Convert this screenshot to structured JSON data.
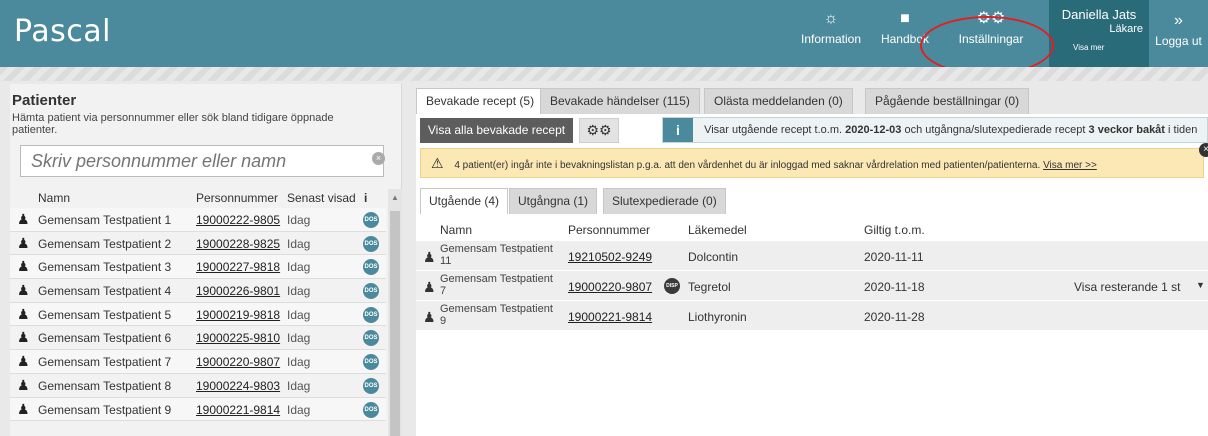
{
  "app": {
    "title": "Pascal"
  },
  "nav": [
    {
      "label": "Information",
      "icon": "lightbulb-icon",
      "glyph": "☼"
    },
    {
      "label": "Handbok",
      "icon": "book-icon",
      "glyph": "■"
    },
    {
      "label": "Inställningar",
      "icon": "gears-icon",
      "glyph": "⚙⚙"
    }
  ],
  "user": {
    "name": "Daniella Jats",
    "role": "Läkare",
    "more": "Visa mer"
  },
  "logout": {
    "label": "Logga ut",
    "glyph": "»"
  },
  "patients": {
    "title": "Patienter",
    "hint": "Hämta patient via personnummer eller sök bland tidigare öppnade patienter.",
    "search_placeholder": "Skriv personnummer eller namn",
    "columns": {
      "name": "Namn",
      "pnr": "Personnummer",
      "seen": "Senast visad",
      "info": "i"
    },
    "rows": [
      {
        "name": "Gemensam Testpatient 1",
        "pnr": "19000222-9805",
        "seen": "Idag",
        "badge": "DOS"
      },
      {
        "name": "Gemensam Testpatient 2",
        "pnr": "19000228-9825",
        "seen": "Idag",
        "badge": "DOS"
      },
      {
        "name": "Gemensam Testpatient 3",
        "pnr": "19000227-9818",
        "seen": "Idag",
        "badge": "DOS"
      },
      {
        "name": "Gemensam Testpatient 4",
        "pnr": "19000226-9801",
        "seen": "Idag",
        "badge": "DOS"
      },
      {
        "name": "Gemensam Testpatient 5",
        "pnr": "19000219-9818",
        "seen": "Idag",
        "badge": "DOS"
      },
      {
        "name": "Gemensam Testpatient 6",
        "pnr": "19000225-9810",
        "seen": "Idag",
        "badge": "DOS"
      },
      {
        "name": "Gemensam Testpatient 7",
        "pnr": "19000220-9807",
        "seen": "Idag",
        "badge": "DOS"
      },
      {
        "name": "Gemensam Testpatient 8",
        "pnr": "19000224-9803",
        "seen": "Idag",
        "badge": "DOS"
      },
      {
        "name": "Gemensam Testpatient 9",
        "pnr": "19000221-9814",
        "seen": "Idag",
        "badge": "DOS"
      }
    ]
  },
  "main_tabs": [
    {
      "label": "Bevakade recept (5)",
      "active": true
    },
    {
      "label": "Bevakade händelser (115)",
      "active": false
    },
    {
      "label": "Olästa meddelanden (0)",
      "active": false
    },
    {
      "label": "Pågående beställningar (0)",
      "active": false
    }
  ],
  "toolbar": {
    "show_all_label": "Visa alla bevakade recept",
    "gear_glyph": "⚙⚙"
  },
  "info": {
    "icon_glyph": "i",
    "text_before": "Visar utgående recept t.o.m. ",
    "date": "2020-12-03",
    "text_middle": " och utgångna/slutexpedierade recept ",
    "weeks": "3 veckor bakåt",
    "text_after": " i tiden"
  },
  "warning": {
    "icon_glyph": "⚠",
    "text": "4 patient(er) ingår inte i bevakningslistan p.g.a. att den vårdenhet du är inloggad med saknar vårdrelation med patienten/patienterna. ",
    "link": "Visa mer >>",
    "close_glyph": "×"
  },
  "sub_tabs": [
    {
      "label": "Utgående (4)",
      "active": true
    },
    {
      "label": "Utgångna (1)",
      "active": false
    },
    {
      "label": "Slutexpedierade (0)",
      "active": false
    }
  ],
  "prescriptions": {
    "columns": {
      "name": "Namn",
      "pnr": "Personnummer",
      "drug": "Läkemedel",
      "valid": "Giltig t.o.m."
    },
    "rows": [
      {
        "name": "Gemensam Testpatient 11",
        "pnr": "19210502-9249",
        "disp": "",
        "drug": "Dolcontin",
        "valid": "2020-11-11",
        "extra": ""
      },
      {
        "name": "Gemensam Testpatient 7",
        "pnr": "19000220-9807",
        "disp": "DISP",
        "drug": "Tegretol",
        "valid": "2020-11-18",
        "extra": "Visa resterande 1 st"
      },
      {
        "name": "Gemensam Testpatient 9",
        "pnr": "19000221-9814",
        "disp": "",
        "drug": "Liothyronin",
        "valid": "2020-11-28",
        "extra": ""
      }
    ]
  },
  "colors": {
    "header": "#4b8a9c",
    "header_dark": "#2a6b7a",
    "warning_bg": "#fbe8b5",
    "highlight": "#e02020"
  }
}
